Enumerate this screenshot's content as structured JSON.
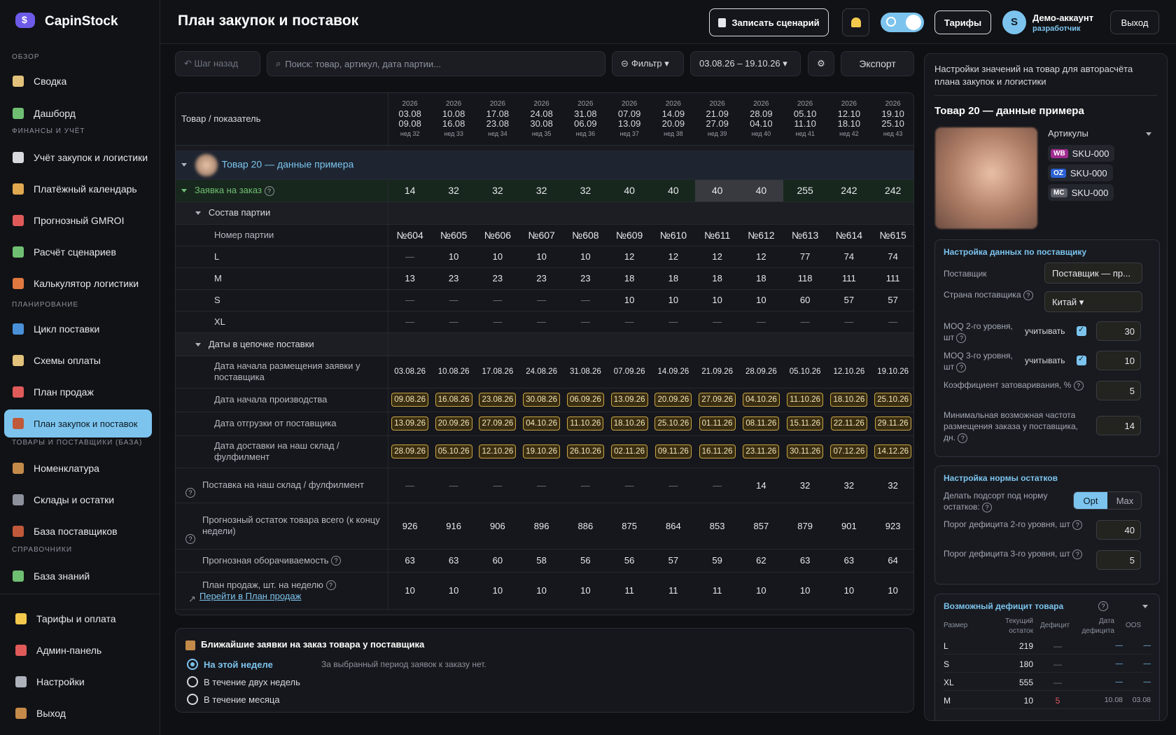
{
  "app": {
    "name": "CapinStock"
  },
  "sidebar": {
    "sections": [
      {
        "title": "ОБЗОР"
      },
      {
        "title": "ФИНАНСЫ И УЧЁТ"
      },
      {
        "title": "ПЛАНИРОВАНИЕ"
      },
      {
        "title": "ТОВАРЫ И ПОСТАВЩИКИ (БАЗА)"
      },
      {
        "title": "СПРАВОЧНИКИ"
      }
    ],
    "items": [
      {
        "label": "Сводка",
        "icon": "clipboard-icon",
        "color": "#e2c27a"
      },
      {
        "label": "Дашборд",
        "icon": "bar-chart-icon",
        "color": "#6fbf73"
      },
      {
        "label": "Учёт закупок и логистики",
        "icon": "receipt-icon",
        "color": "#d7d9df"
      },
      {
        "label": "Платёжный календарь",
        "icon": "money-bag-icon",
        "color": "#e0a84f"
      },
      {
        "label": "Прогнозный GMROI",
        "icon": "target-icon",
        "color": "#e05a5a"
      },
      {
        "label": "Расчёт сценариев",
        "icon": "pencil-icon",
        "color": "#6fbf73"
      },
      {
        "label": "Калькулятор логистики",
        "icon": "truck-icon",
        "color": "#e0783f"
      },
      {
        "label": "Цикл поставки",
        "icon": "cycle-icon",
        "color": "#4a90d9"
      },
      {
        "label": "Схемы оплаты",
        "icon": "card-icon",
        "color": "#e2c27a"
      },
      {
        "label": "План продаж",
        "icon": "trend-icon",
        "color": "#e05a5a"
      },
      {
        "label": "План закупок и поставок",
        "icon": "bricks-icon",
        "color": "#c0583a"
      },
      {
        "label": "Номенклатура",
        "icon": "box-icon",
        "color": "#c48a4a"
      },
      {
        "label": "Склады и остатки",
        "icon": "warehouse-icon",
        "color": "#8d919c"
      },
      {
        "label": "База поставщиков",
        "icon": "factory-icon",
        "color": "#c0583a"
      },
      {
        "label": "База знаний",
        "icon": "books-icon",
        "color": "#6fbf73"
      }
    ],
    "bottom": [
      {
        "label": "Тарифы и оплата",
        "icon": "star-icon",
        "color": "#f2c94c"
      },
      {
        "label": "Админ-панель",
        "icon": "shield-icon",
        "color": "#e05a5a"
      },
      {
        "label": "Настройки",
        "icon": "gear-icon",
        "color": "#aeb2bb"
      },
      {
        "label": "Выход",
        "icon": "door-icon",
        "color": "#c48a4a"
      }
    ]
  },
  "header": {
    "title": "План закупок и поставок",
    "record_label": "Записать сценарий",
    "tariffs_label": "Тарифы",
    "avatar_letter": "S",
    "user_name": "Демо-аккаунт",
    "user_role": "разработчик",
    "logout_label": "Выход"
  },
  "toolbar": {
    "back_label": "↶ Шаг назад",
    "search_placeholder": "Поиск: товар, артикул, дата партии...",
    "filter_label": "Фильтр ▾",
    "date_range": "03.08.26 – 19.10.26 ▾",
    "export_label": "Экспорт"
  },
  "table": {
    "header_label": "Товар / показатель",
    "weeks": [
      {
        "year": "2026",
        "from": "03.08",
        "to": "09.08",
        "week": "нед 32"
      },
      {
        "year": "2026",
        "from": "10.08",
        "to": "16.08",
        "week": "нед 33"
      },
      {
        "year": "2026",
        "from": "17.08",
        "to": "23.08",
        "week": "нед 34"
      },
      {
        "year": "2026",
        "from": "24.08",
        "to": "30.08",
        "week": "нед 35"
      },
      {
        "year": "2026",
        "from": "31.08",
        "to": "06.09",
        "week": "нед 36"
      },
      {
        "year": "2026",
        "from": "07.09",
        "to": "13.09",
        "week": "нед 37"
      },
      {
        "year": "2026",
        "from": "14.09",
        "to": "20.09",
        "week": "нед 38"
      },
      {
        "year": "2026",
        "from": "21.09",
        "to": "27.09",
        "week": "нед 39"
      },
      {
        "year": "2026",
        "from": "28.09",
        "to": "04.10",
        "week": "нед 40"
      },
      {
        "year": "2026",
        "from": "05.10",
        "to": "11.10",
        "week": "нед 41"
      },
      {
        "year": "2026",
        "from": "12.10",
        "to": "18.10",
        "week": "нед 42"
      },
      {
        "year": "2026",
        "from": "19.10",
        "to": "25.10",
        "week": "нед 43"
      }
    ],
    "product_name": "Товар 20 — данные примера",
    "order_label": "Заявка на заказ",
    "order_values": [
      "14",
      "32",
      "32",
      "32",
      "32",
      "40",
      "40",
      "40",
      "40",
      "255",
      "242",
      "242"
    ],
    "batch_section": "Состав партии",
    "batch_label": "Номер партии",
    "batch_values": [
      "№604",
      "№605",
      "№606",
      "№607",
      "№608",
      "№609",
      "№610",
      "№611",
      "№612",
      "№613",
      "№614",
      "№615"
    ],
    "sizes": [
      {
        "label": "L",
        "values": [
          "—",
          "10",
          "10",
          "10",
          "10",
          "12",
          "12",
          "12",
          "12",
          "77",
          "74",
          "74"
        ]
      },
      {
        "label": "M",
        "values": [
          "13",
          "23",
          "23",
          "23",
          "23",
          "18",
          "18",
          "18",
          "18",
          "118",
          "111",
          "111"
        ]
      },
      {
        "label": "S",
        "values": [
          "—",
          "—",
          "—",
          "—",
          "—",
          "10",
          "10",
          "10",
          "10",
          "60",
          "57",
          "57"
        ]
      },
      {
        "label": "XL",
        "values": [
          "—",
          "—",
          "—",
          "—",
          "—",
          "—",
          "—",
          "—",
          "—",
          "—",
          "—",
          "—"
        ]
      }
    ],
    "chain_section": "Даты в цепочке поставки",
    "placement_label": "Дата начала размещения заявки у поставщика",
    "placement_values": [
      "03.08.26",
      "10.08.26",
      "17.08.26",
      "24.08.26",
      "31.08.26",
      "07.09.26",
      "14.09.26",
      "21.09.26",
      "28.09.26",
      "05.10.26",
      "12.10.26",
      "19.10.26"
    ],
    "production_label": "Дата начала производства",
    "production_values": [
      "09.08.26",
      "16.08.26",
      "23.08.26",
      "30.08.26",
      "06.09.26",
      "13.09.26",
      "20.09.26",
      "27.09.26",
      "04.10.26",
      "11.10.26",
      "18.10.26",
      "25.10.26"
    ],
    "shipment_label": "Дата отгрузки от поставщика",
    "shipment_values": [
      "13.09.26",
      "20.09.26",
      "27.09.26",
      "04.10.26",
      "11.10.26",
      "18.10.26",
      "25.10.26",
      "01.11.26",
      "08.11.26",
      "15.11.26",
      "22.11.26",
      "29.11.26"
    ],
    "delivery_label": "Дата доставки на наш склад / фулфилмент",
    "delivery_values": [
      "28.09.26",
      "05.10.26",
      "12.10.26",
      "19.10.26",
      "26.10.26",
      "02.11.26",
      "09.11.26",
      "16.11.26",
      "23.11.26",
      "30.11.26",
      "07.12.26",
      "14.12.26"
    ],
    "supply_label": "Поставка на наш склад / фулфилмент",
    "supply_values": [
      "—",
      "—",
      "—",
      "—",
      "—",
      "—",
      "—",
      "—",
      "14",
      "32",
      "32",
      "32"
    ],
    "stock_label": "Прогнозный остаток товара всего (к концу недели)",
    "stock_values": [
      "926",
      "916",
      "906",
      "896",
      "886",
      "875",
      "864",
      "853",
      "857",
      "879",
      "901",
      "923"
    ],
    "turnover_label": "Прогнозная оборачиваемость",
    "turnover_values": [
      "63",
      "63",
      "60",
      "58",
      "56",
      "56",
      "57",
      "59",
      "62",
      "63",
      "63",
      "64"
    ],
    "sales_label": "План продаж, шт. на неделю",
    "sales_link": "Перейти в План продаж",
    "sales_values": [
      "10",
      "10",
      "10",
      "10",
      "10",
      "11",
      "11",
      "11",
      "10",
      "10",
      "10",
      "10"
    ]
  },
  "bottom_panel": {
    "title": "Ближайшие заявки на заказ товара у поставщика",
    "options": [
      "На этой неделе",
      "В течение двух недель",
      "В течение месяца"
    ],
    "empty_text": "За выбранный период заявок к заказу нет."
  },
  "right_panel": {
    "intro": "Настройки значений на товар для авторасчёта плана закупок и логистики",
    "product_title": "Товар 20 — данные примера",
    "articles_label": "Артикулы",
    "articles": [
      {
        "badge": "WB",
        "sku": "SKU-000",
        "color": "#a12b8f"
      },
      {
        "badge": "OZ",
        "sku": "SKU-000",
        "color": "#2a62d4"
      },
      {
        "badge": "MC",
        "sku": "SKU-000",
        "color": "#5a5d66"
      }
    ],
    "supplier_card": {
      "title": "Настройка данных по поставщику",
      "supplier_label": "Поставщик",
      "supplier_value": "Поставщик — пр...",
      "country_label": "Страна поставщика",
      "country_value": "Китай ▾",
      "moq2_label": "MOQ 2-го уровня, шт",
      "moq2_check": "учитывать",
      "moq2_value": "30",
      "moq3_label": "MOQ 3-го уровня, шт",
      "moq3_check": "учитывать",
      "moq3_value": "10",
      "overstock_label": "Коэффициент затоваривания, %",
      "overstock_value": "5",
      "freq_label": "Минимальная возможная частота размещения заказа у поставщика, дн.",
      "freq_value": "14"
    },
    "norm_card": {
      "title": "Настройка нормы остатков",
      "restock_label": "Делать подсорт под норму остатков:",
      "opt_label": "Opt",
      "max_label": "Max",
      "def2_label": "Порог дефицита 2-го уровня, шт",
      "def2_value": "40",
      "def3_label": "Порог дефицита 3-го уровня, шт",
      "def3_value": "5"
    },
    "deficit_card": {
      "title": "Возможный дефицит товара",
      "col_size": "Размер",
      "col_stock": "Текущий остаток",
      "col_deficit": "Дефицит",
      "col_date": "Дата дефицита",
      "col_oos": "OOS",
      "rows": [
        {
          "size": "L",
          "stock": "219",
          "deficit": "—",
          "date": "—",
          "oos": "—"
        },
        {
          "size": "S",
          "stock": "180",
          "deficit": "—",
          "date": "—",
          "oos": "—"
        },
        {
          "size": "XL",
          "stock": "555",
          "deficit": "—",
          "date": "—",
          "oos": "—"
        },
        {
          "size": "M",
          "stock": "10",
          "deficit": "5",
          "date": "10.08",
          "oos": "03.08"
        }
      ]
    }
  }
}
